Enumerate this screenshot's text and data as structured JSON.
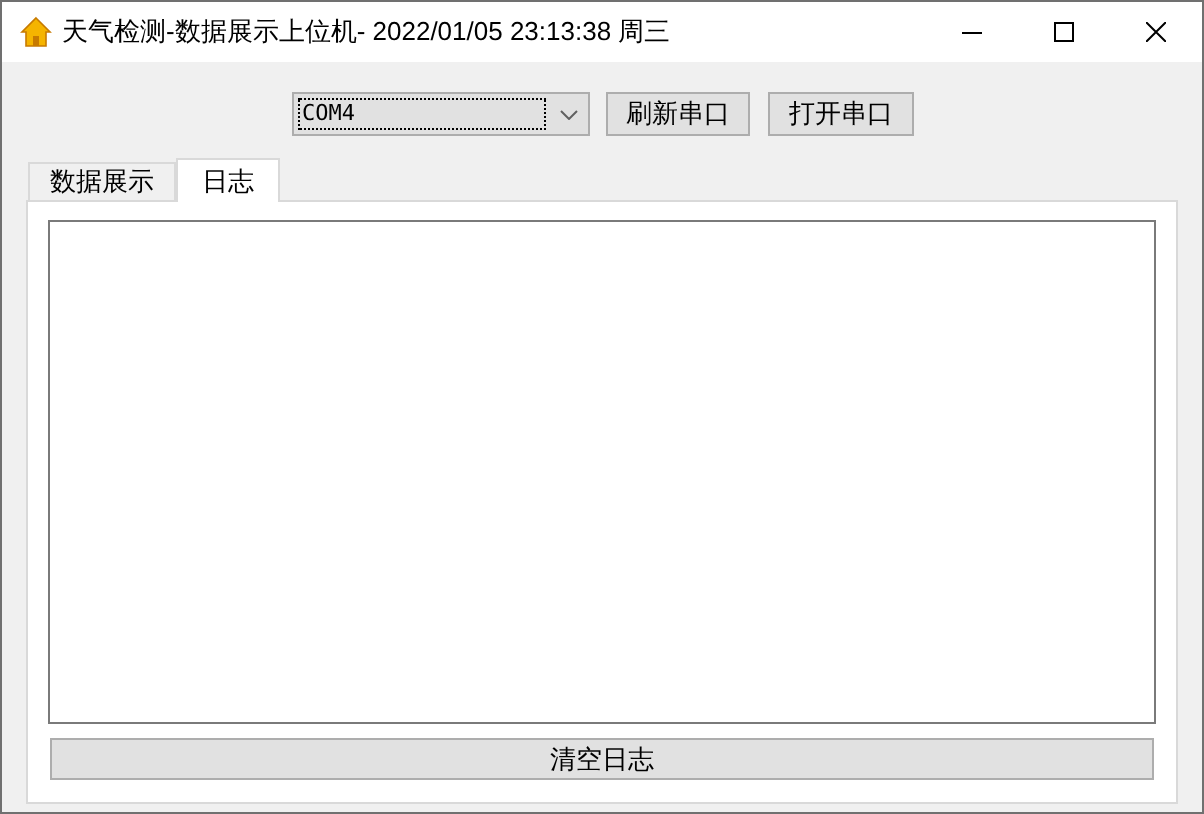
{
  "window": {
    "title": "天气检测-数据展示上位机- 2022/01/05 23:13:38 周三"
  },
  "port_select": {
    "value": "COM4"
  },
  "buttons": [
    {
      "label": "刷新串口"
    },
    {
      "label": "打开串口"
    }
  ],
  "tabs": [
    {
      "label": "数据展示",
      "selected": false
    },
    {
      "label": "日志",
      "selected": true
    }
  ],
  "clear_button": {
    "label": "清空日志"
  }
}
